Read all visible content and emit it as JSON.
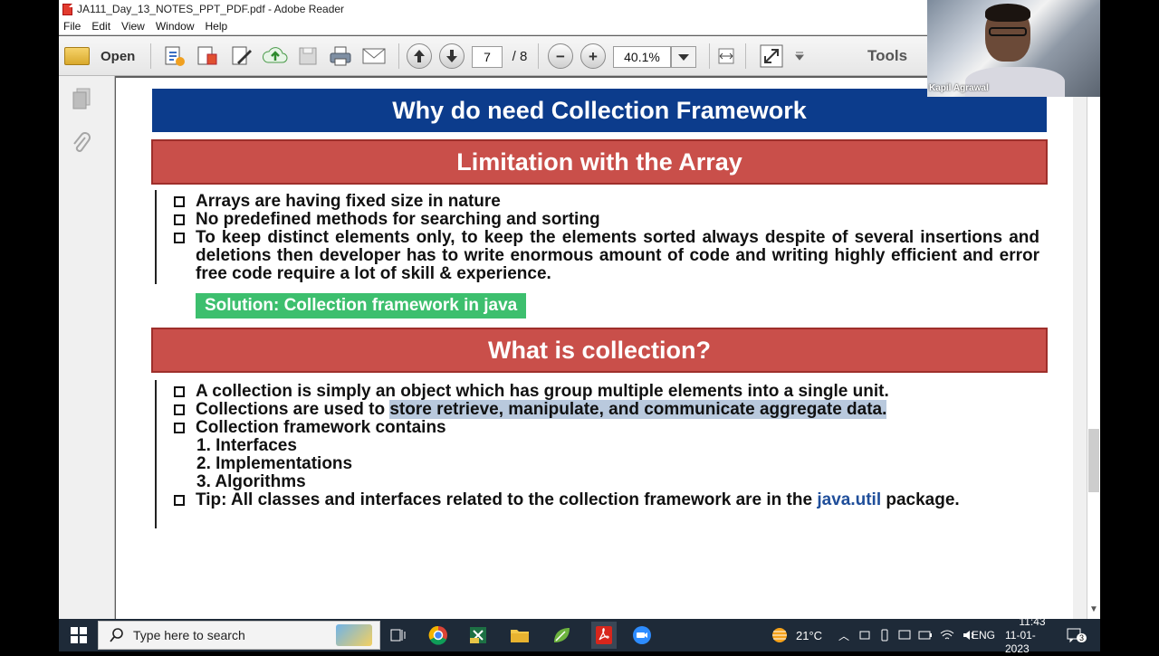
{
  "window": {
    "title": "JA111_Day_13_NOTES_PPT_PDF.pdf - Adobe Reader"
  },
  "menu": [
    "File",
    "Edit",
    "View",
    "Window",
    "Help"
  ],
  "toolbar": {
    "open_label": "Open",
    "page_current": "7",
    "page_total": "/ 8",
    "zoom_value": "40.1%",
    "tools_label": "Tools",
    "plus_symbol": "+",
    "minus_symbol": "−"
  },
  "slide": {
    "title": "Why do need Collection Framework",
    "section1_heading": "Limitation with the Array",
    "section1_bullets": [
      "Arrays are having fixed size in nature",
      "No predefined methods for searching and sorting",
      "To keep distinct elements only, to keep the elements sorted always despite of several insertions and deletions then developer has to write enormous amount of code and writing highly efficient and error free code require a lot of skill & experience."
    ],
    "solution": "Solution: Collection framework in java",
    "section2_heading": "What is collection?",
    "section2_bullet1": "A collection is simply an object which has group multiple elements into a single unit.",
    "section2_bullet2_plain": "Collections are used to ",
    "section2_bullet2_highlight": "store retrieve, manipulate, and communicate aggregate data.",
    "section2_bullet3": "Collection framework contains",
    "section2_list": [
      "1.  Interfaces",
      "2.  Implementations",
      "3.  Algorithms"
    ],
    "tip_plain": "Tip: All classes and interfaces related to the collection framework are in the ",
    "tip_blue": "java.util",
    "tip_end": " package."
  },
  "video": {
    "participant_name": "Kapil Agrawal"
  },
  "taskbar": {
    "search_placeholder": "Type here to search",
    "weather": "21°C",
    "language": "ENG",
    "time": "11:43",
    "date": "11-01-2023",
    "notification_count": "3"
  }
}
